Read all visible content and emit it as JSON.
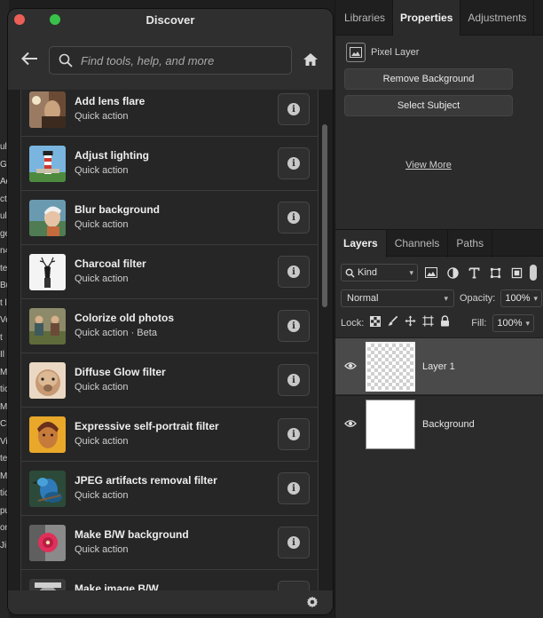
{
  "dialog": {
    "title": "Discover",
    "search_placeholder": "Find tools, help, and more",
    "items": [
      {
        "title": "Add lens flare",
        "subtitle": "Quick action"
      },
      {
        "title": "Adjust lighting",
        "subtitle": "Quick action"
      },
      {
        "title": "Blur background",
        "subtitle": "Quick action"
      },
      {
        "title": "Charcoal filter",
        "subtitle": "Quick action"
      },
      {
        "title": "Colorize old photos",
        "subtitle": "Quick action  ·  Beta"
      },
      {
        "title": "Diffuse Glow filter",
        "subtitle": "Quick action"
      },
      {
        "title": "Expressive self-portrait filter",
        "subtitle": "Quick action"
      },
      {
        "title": "JPEG artifacts removal filter",
        "subtitle": "Quick action"
      },
      {
        "title": "Make B/W background",
        "subtitle": "Quick action"
      },
      {
        "title": "Make image B/W",
        "subtitle": ""
      }
    ],
    "info_glyph": "i"
  },
  "properties_panel": {
    "tabs": [
      "Libraries",
      "Properties",
      "Adjustments"
    ],
    "active_tab": "Properties",
    "pixel_layer_label": "Pixel Layer",
    "remove_background": "Remove Background",
    "select_subject": "Select Subject",
    "view_more": "View More"
  },
  "layers_panel": {
    "tabs": [
      "Layers",
      "Channels",
      "Paths"
    ],
    "active_tab": "Layers",
    "filter_kind": "Kind",
    "blend_mode": "Normal",
    "opacity_label": "Opacity:",
    "opacity_value": "100%",
    "lock_label": "Lock:",
    "fill_label": "Fill:",
    "fill_value": "100%",
    "layers": [
      {
        "name": "Layer 1",
        "selected": true
      },
      {
        "name": "Background",
        "selected": false
      }
    ]
  },
  "left_fragments": [
    "ult",
    "Go",
    "Ad",
    "ct",
    "ul",
    "ge",
    "n4",
    "te",
    "Bu",
    "t l",
    "Ve",
    "t",
    "Il",
    "Ma",
    "tic",
    "Ma",
    "Cl",
    "Vi",
    "te",
    "Mo",
    "tic",
    "pu",
    "on",
    "Ji"
  ],
  "colors": {
    "traffic_red": "#ec5f57",
    "traffic_green": "#39c249",
    "selected_layer": "#4a4a4a"
  }
}
